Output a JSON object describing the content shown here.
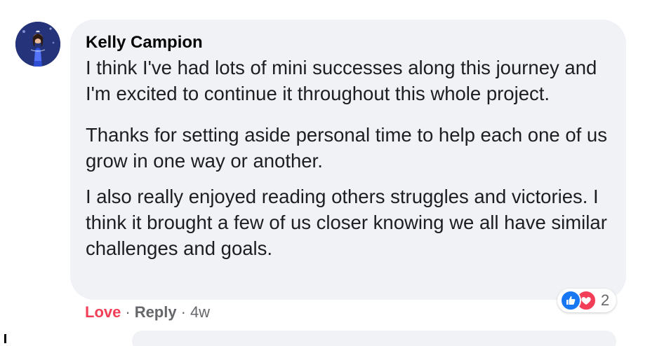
{
  "comment": {
    "author": "Kelly Campion",
    "paragraphs": [
      "I think I've had lots of mini successes along this journey and I'm excited to continue it throughout this whole project.",
      "Thanks for setting aside personal time to help each one of us grow in one way or another.",
      "I also really enjoyed reading others struggles and victories. I think it brought a few of us closer knowing we all have similar challenges and goals."
    ]
  },
  "reactions": {
    "icons": [
      "like-icon",
      "love-icon"
    ],
    "count": "2"
  },
  "actions": {
    "reaction_label": "Love",
    "reply_label": "Reply",
    "separator": "·",
    "timestamp": "4w"
  },
  "colors": {
    "bubble": "#f0f2f5",
    "love": "#f33e58",
    "like": "#1877f2",
    "meta_text": "#65676b"
  }
}
